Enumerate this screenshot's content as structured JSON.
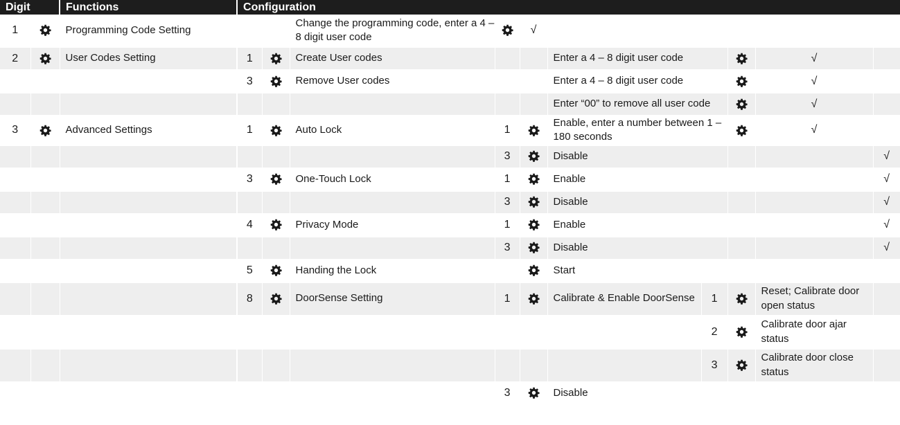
{
  "headers": {
    "digit": "Digit",
    "functions": "Functions",
    "configuration": "Configuration"
  },
  "rows": [
    {
      "d": "1",
      "f": "Programming Code Setting",
      "c1": "",
      "t1": "Change the programming code, enter a 4 – 8 digit user code",
      "c2": "",
      "t2": "",
      "c3": "",
      "t3": "",
      "ck": "√",
      "ckpos": "early",
      "gear2": "early"
    },
    {
      "d": "2",
      "f": "User Codes Setting",
      "c1": "1",
      "t1": "Create User codes",
      "c2": "",
      "t2": "Enter a 4 – 8 digit user code",
      "ck": "√"
    },
    {
      "d": "",
      "f": "",
      "c1": "3",
      "t1": "Remove User codes",
      "c2": "",
      "t2": "Enter a 4 – 8 digit user code",
      "ck": "√"
    },
    {
      "d": "",
      "f": "",
      "c1": "",
      "t1": "",
      "c2": "",
      "t2": "Enter “00”  to remove all user code",
      "ck": "√"
    },
    {
      "d": "3",
      "f": "Advanced Settings",
      "c1": "1",
      "t1": "Auto Lock",
      "c2": "1",
      "t2": "Enable, enter a number between 1 – 180 seconds",
      "ck": "√"
    },
    {
      "c2": "3",
      "t2": "Disable",
      "ck": "√"
    },
    {
      "c1": "3",
      "t1": "One-Touch Lock",
      "c2": "1",
      "t2": "Enable",
      "ck": "√"
    },
    {
      "c2": "3",
      "t2": "Disable",
      "ck": "√"
    },
    {
      "c1": "4",
      "t1": "Privacy Mode",
      "c2": "1",
      "t2": "Enable",
      "ck": "√"
    },
    {
      "c2": "3",
      "t2": "Disable",
      "ck": "√"
    },
    {
      "c1": "5",
      "t1": "Handing the Lock",
      "c2": "",
      "t2": "Start"
    },
    {
      "c1": "8",
      "t1": "DoorSense Setting",
      "c2": "1",
      "t2": "Calibrate & Enable DoorSense",
      "c3": "1",
      "t3": "Reset; Calibrate door open status"
    },
    {
      "c3": "2",
      "t3": "Calibrate door ajar status"
    },
    {
      "c3": "3",
      "t3": "Calibrate door close status"
    },
    {
      "c2": "3",
      "t2": "Disable"
    }
  ],
  "icon": "gear-icon"
}
